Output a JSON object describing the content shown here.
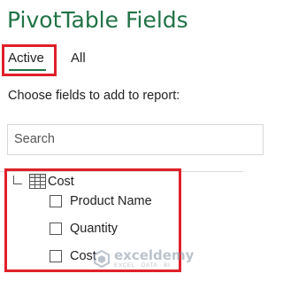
{
  "panel": {
    "title": "PivotTable Fields",
    "tabs": [
      {
        "label": "Active",
        "selected": true
      },
      {
        "label": "All",
        "selected": false
      }
    ],
    "instruction": "Choose fields to add to report:",
    "search": {
      "placeholder": "Search",
      "value": ""
    }
  },
  "tree": {
    "table_icon": "table-icon",
    "collapse_icon": "collapse-icon",
    "table_name": "Cost",
    "fields": [
      {
        "label": "Product Name",
        "checked": false
      },
      {
        "label": "Quantity",
        "checked": false
      },
      {
        "label": "Cost",
        "checked": false
      }
    ]
  },
  "watermark": {
    "name": "exceldemy",
    "tagline": "EXCEL · DATA · BI"
  },
  "colors": {
    "accent": "#217346",
    "highlight": "#e0202a"
  }
}
